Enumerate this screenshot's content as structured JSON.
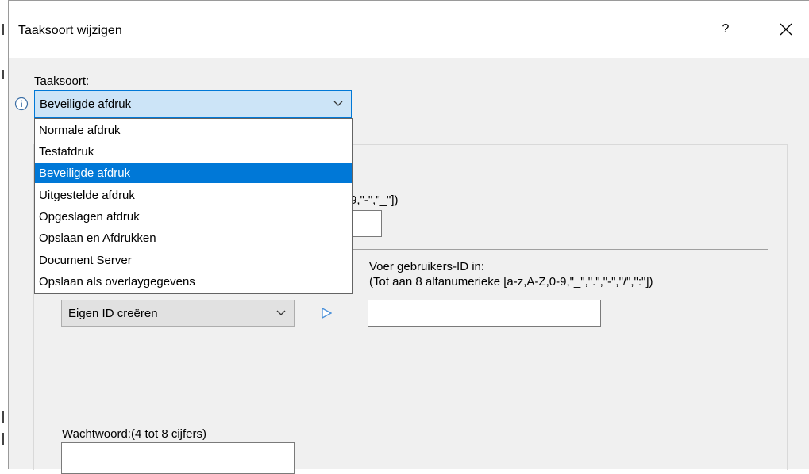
{
  "dialog": {
    "title": "Taaksoort wijzigen",
    "help_label": "?"
  },
  "job_type": {
    "label": "Taaksoort:",
    "selected_value": "Beveiligde afdruk",
    "options": [
      "Normale afdruk",
      "Testafdruk",
      "Beveiligde afdruk",
      "Uitgestelde afdruk",
      "Opgeslagen afdruk",
      "Opslaan en Afdrukken",
      "Document Server",
      "Opslaan als overlaygegevens"
    ],
    "highlighted_index": 2
  },
  "document_name": {
    "hint_fragment": "9,\"-\",\"_\"])"
  },
  "user_id": {
    "combo_value": "Eigen ID creëren",
    "label": "Voer gebruikers-ID in:",
    "hint": "(Tot aan 8 alfanumerieke [a-z,A-Z,0-9,\"_\",\".\",\"-\",\"/\",\":\"])"
  },
  "password": {
    "label": "Wachtwoord:(4 tot 8 cijfers)"
  },
  "colors": {
    "accent": "#0078d7",
    "combo_highlight": "#cce4f7",
    "window_bg": "#f0f0f0"
  },
  "icons": {
    "info": "info-icon",
    "chevron": "chevron-down-icon",
    "close": "close-icon",
    "arrow": "play-arrow-icon"
  }
}
